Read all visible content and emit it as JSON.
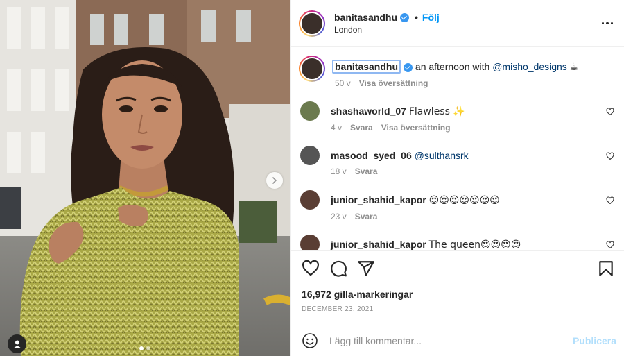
{
  "post": {
    "header": {
      "username": "banitasandhu",
      "bullet": "•",
      "follow_label": "Följ",
      "location": "London",
      "more_icon": "more-horizontal-icon"
    },
    "caption": {
      "username": "banitasandhu",
      "text": "an afternoon with",
      "mention": "@misho_designs",
      "emoji": "☕",
      "age": "50 v",
      "translate_label": "Visa översättning"
    },
    "comments": [
      {
        "username": "shashaworld_07",
        "text": "Flawless ✨",
        "age": "4 v",
        "reply_label": "Svara",
        "translate_label": "Visa översättning"
      },
      {
        "username": "masood_syed_06",
        "mention": "@sulthansrk",
        "age": "18 v",
        "reply_label": "Svara"
      },
      {
        "username": "junior_shahid_kapor",
        "text": "😍😍😍😍😍😍😍",
        "age": "23 v",
        "reply_label": "Svara"
      },
      {
        "username": "junior_shahid_kapor",
        "text": "The queen😍😍😍😍"
      }
    ],
    "likes_text": "16,972 gilla-markeringar",
    "date": "DECEMBER 23, 2021",
    "add_comment": {
      "placeholder": "Lägg till kommentar...",
      "publish_label": "Publicera"
    },
    "icons": [
      "heart-icon",
      "comment-icon",
      "share-icon",
      "bookmark-icon",
      "smile-icon",
      "chevron-right-icon",
      "user-tag-icon"
    ],
    "colors": {
      "accent": "#0095f6",
      "verified": "#3897f0",
      "publish_disabled": "#b2dffc",
      "muted": "#8e8e8e"
    }
  }
}
